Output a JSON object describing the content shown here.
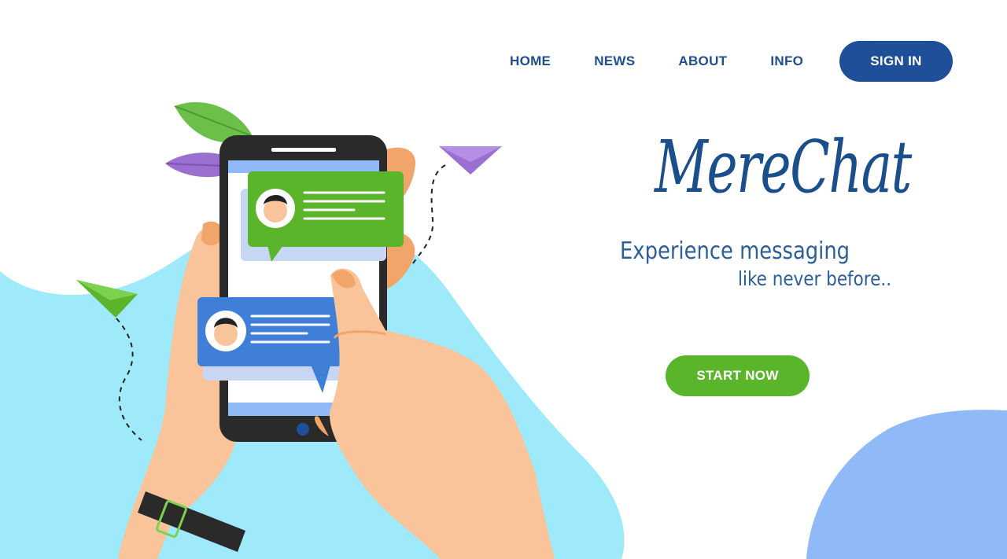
{
  "nav": {
    "items": [
      {
        "label": "HOME"
      },
      {
        "label": "NEWS"
      },
      {
        "label": "ABOUT"
      },
      {
        "label": "INFO"
      }
    ],
    "signin_label": "SIGN IN"
  },
  "hero": {
    "brand": "MereChat",
    "tagline_line1": "Experience messaging",
    "tagline_line2": "like never before..",
    "cta_label": "START NOW"
  },
  "colors": {
    "nav_text": "#1f4e8f",
    "signin_bg": "#1f4f99",
    "brand_text": "#1a4f8c",
    "cta_bg": "#5ab52a",
    "blob_cyan": "#9eeafa",
    "blob_blue": "#8fbaf7",
    "bubble_green": "#5ab52a",
    "bubble_blue": "#3f7fd8"
  },
  "illustration": {
    "icons": [
      "phone-icon",
      "hand-icon",
      "chat-bubble-icon",
      "avatar-icon",
      "paper-plane-icon",
      "leaf-icon",
      "watch-icon"
    ]
  }
}
